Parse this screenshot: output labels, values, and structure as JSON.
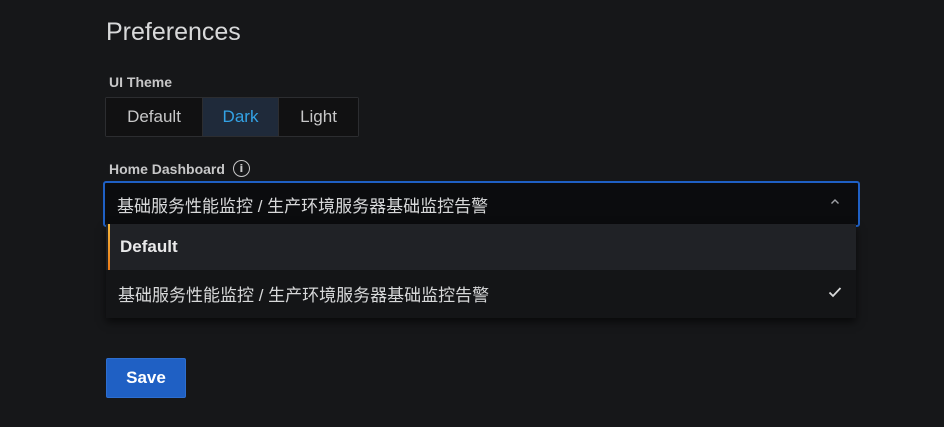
{
  "page": {
    "title": "Preferences"
  },
  "theme": {
    "label": "UI Theme",
    "options": [
      "Default",
      "Dark",
      "Light"
    ],
    "selected": "Dark"
  },
  "home_dashboard": {
    "label": "Home Dashboard",
    "info_icon": "info-circle-icon",
    "value": "基础服务性能监控 / 生产环境服务器基础监控告警",
    "options": [
      {
        "label": "Default",
        "focused": true,
        "selected": false
      },
      {
        "label": "基础服务性能监控 / 生产环境服务器基础监控告警",
        "focused": false,
        "selected": true
      }
    ]
  },
  "actions": {
    "save_label": "Save"
  },
  "colors": {
    "background": "#161719",
    "accent": "#1f60c4",
    "selected_text": "#33a2e5",
    "focus_bar": "#f5b73d"
  }
}
